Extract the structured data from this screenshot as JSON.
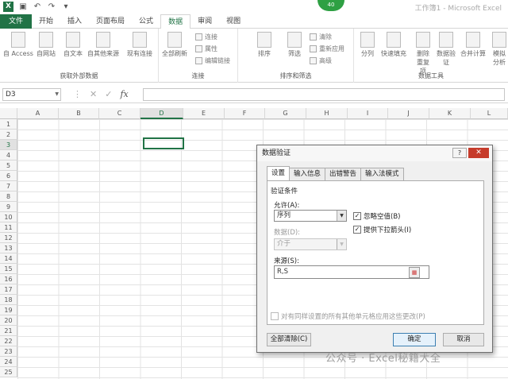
{
  "window": {
    "title": "工作簿1 - Microsoft Excel",
    "badge": "40"
  },
  "tabs": {
    "file": "文件",
    "items": [
      "开始",
      "插入",
      "页面布局",
      "公式",
      "数据",
      "审阅",
      "视图"
    ],
    "active_index": 4
  },
  "ribbon": {
    "groups": {
      "external": {
        "label": "获取外部数据",
        "buttons": [
          "自 Access",
          "自网站",
          "自文本",
          "自其他来源",
          "现有连接"
        ]
      },
      "connections": {
        "label": "连接",
        "big": "全部刷新",
        "small": [
          "连接",
          "属性",
          "编辑链接"
        ]
      },
      "sortfilter": {
        "label": "排序和筛选",
        "big": [
          "排序",
          "筛选"
        ],
        "small": [
          "清除",
          "重新应用",
          "高级"
        ]
      },
      "datatools": {
        "label": "数据工具",
        "buttons": [
          "分列",
          "快速填充",
          "删除重复项",
          "数据验证",
          "合并计算",
          "模拟分析"
        ]
      }
    }
  },
  "formula_bar": {
    "name_box": "D3",
    "fx": "fx",
    "value": ""
  },
  "grid": {
    "columns": [
      "A",
      "B",
      "C",
      "D",
      "E",
      "F",
      "G",
      "H",
      "I",
      "J",
      "K",
      "L"
    ],
    "rows": [
      "1",
      "2",
      "3",
      "4",
      "5",
      "6",
      "7",
      "8",
      "9",
      "10",
      "11",
      "12",
      "13",
      "14",
      "15",
      "16",
      "17",
      "18",
      "19",
      "20",
      "21",
      "22",
      "23",
      "24",
      "25"
    ],
    "active_cell": "D3"
  },
  "dialog": {
    "title": "数据验证",
    "help": "?",
    "close": "✕",
    "tabs": [
      "设置",
      "输入信息",
      "出错警告",
      "输入法模式"
    ],
    "section": "验证条件",
    "allow_label": "允许(A):",
    "allow_value": "序列",
    "ignore_blank": "忽略空值(B)",
    "dropdown": "提供下拉箭头(I)",
    "data_label": "数据(D):",
    "data_value": "介于",
    "source_label": "来源(S):",
    "source_value": "R,S",
    "apply_all": "对有同样设置的所有其他单元格应用这些更改(P)",
    "clear_all": "全部清除(C)",
    "ok": "确定",
    "cancel": "取消"
  },
  "watermark": "公众号 · Excel秘籍大全"
}
